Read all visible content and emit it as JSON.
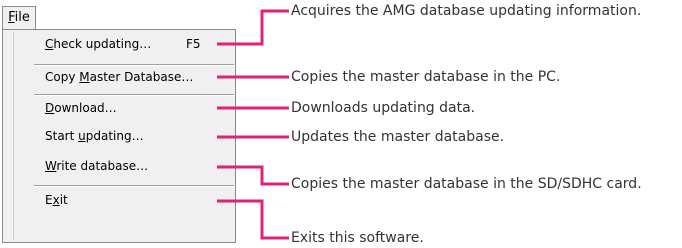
{
  "menu": {
    "title_mnemonic": "F",
    "title_rest": "ile",
    "items": [
      {
        "pre": "",
        "mnemonic": "C",
        "post": "heck updating…",
        "shortcut": "F5"
      },
      {
        "pre": "Copy ",
        "mnemonic": "M",
        "post": "aster Database…",
        "shortcut": ""
      },
      {
        "pre": "",
        "mnemonic": "D",
        "post": "ownload…",
        "shortcut": ""
      },
      {
        "pre": "Start ",
        "mnemonic": "u",
        "post": "pdating…",
        "shortcut": ""
      },
      {
        "pre": "",
        "mnemonic": "W",
        "post": "rite database…",
        "shortcut": ""
      },
      {
        "pre": "E",
        "mnemonic": "x",
        "post": "it",
        "shortcut": ""
      }
    ]
  },
  "descriptions": [
    "Acquires the AMG database updating information.",
    "Copies the master database in the PC.",
    "Downloads updating data.",
    "Updates the master database.",
    "Copies the master database in the SD/SDHC card.",
    "Exits this software."
  ],
  "colors": {
    "connector": "#e0207a",
    "menu_background": "#f0f0f0",
    "description_text": "#333333"
  }
}
